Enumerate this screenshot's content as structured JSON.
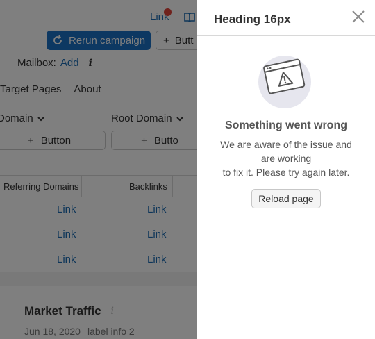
{
  "background": {
    "top_link": "Link",
    "rerun_button": "Rerun campaign",
    "ghost_button": "Butt",
    "mailbox_label": "Mailbox:",
    "mailbox_link": "Add",
    "tabs": [
      "Target Pages",
      "About"
    ],
    "dropdown_1": "Domain",
    "dropdown_2": "Root Domain",
    "add_button_1": "Button",
    "add_button_2": "Butto",
    "table": {
      "headers": [
        "Referring Domains",
        "Backlinks"
      ],
      "rows": [
        [
          "Link",
          "Link"
        ],
        [
          "Link",
          "Link"
        ],
        [
          "Link",
          "Link"
        ]
      ]
    },
    "widget_title": "Market Traffic",
    "widget_date": "Jun 18, 2020",
    "widget_label": "label info 2"
  },
  "panel": {
    "title": "Heading 16px",
    "error_title": "Something went wrong",
    "error_line1": "We are aware of the issue and",
    "error_line2": "are working",
    "error_line3": "to fix it. Please try again later.",
    "reload_button": "Reload page"
  },
  "colors": {
    "primary": "#1b70c4",
    "link": "#1a6bb3",
    "notification": "#e0453b",
    "overlay": "rgba(0,0,0,0.5)"
  }
}
